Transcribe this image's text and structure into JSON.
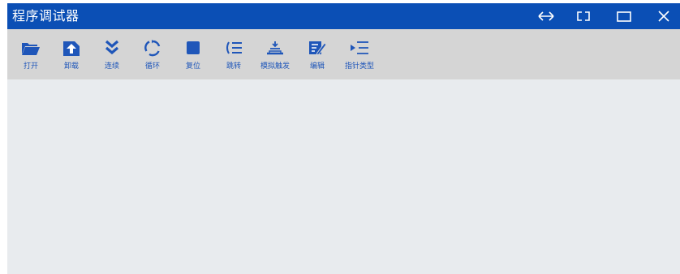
{
  "window": {
    "title": "程序调试器",
    "controls": [
      {
        "name": "swap-icon"
      },
      {
        "name": "split-view-icon"
      },
      {
        "name": "maximize-icon"
      },
      {
        "name": "close-icon"
      }
    ]
  },
  "toolbar": {
    "items": [
      {
        "label": "打开",
        "icon": "folder-open-icon"
      },
      {
        "label": "卸载",
        "icon": "upload-icon"
      },
      {
        "label": "连续",
        "icon": "double-chevron-down-icon"
      },
      {
        "label": "循环",
        "icon": "loop-icon"
      },
      {
        "label": "复位",
        "icon": "stop-square-icon"
      },
      {
        "label": "跳转",
        "icon": "jump-icon"
      },
      {
        "label": "模拟触发",
        "icon": "trigger-icon"
      },
      {
        "label": "编辑",
        "icon": "edit-icon"
      },
      {
        "label": "指针类型",
        "icon": "pointer-type-icon"
      }
    ]
  },
  "colors": {
    "titlebar": "#0b4fb5",
    "toolbar": "#d5d5d5",
    "content": "#e8ebee",
    "accent": "#1f56b9"
  }
}
